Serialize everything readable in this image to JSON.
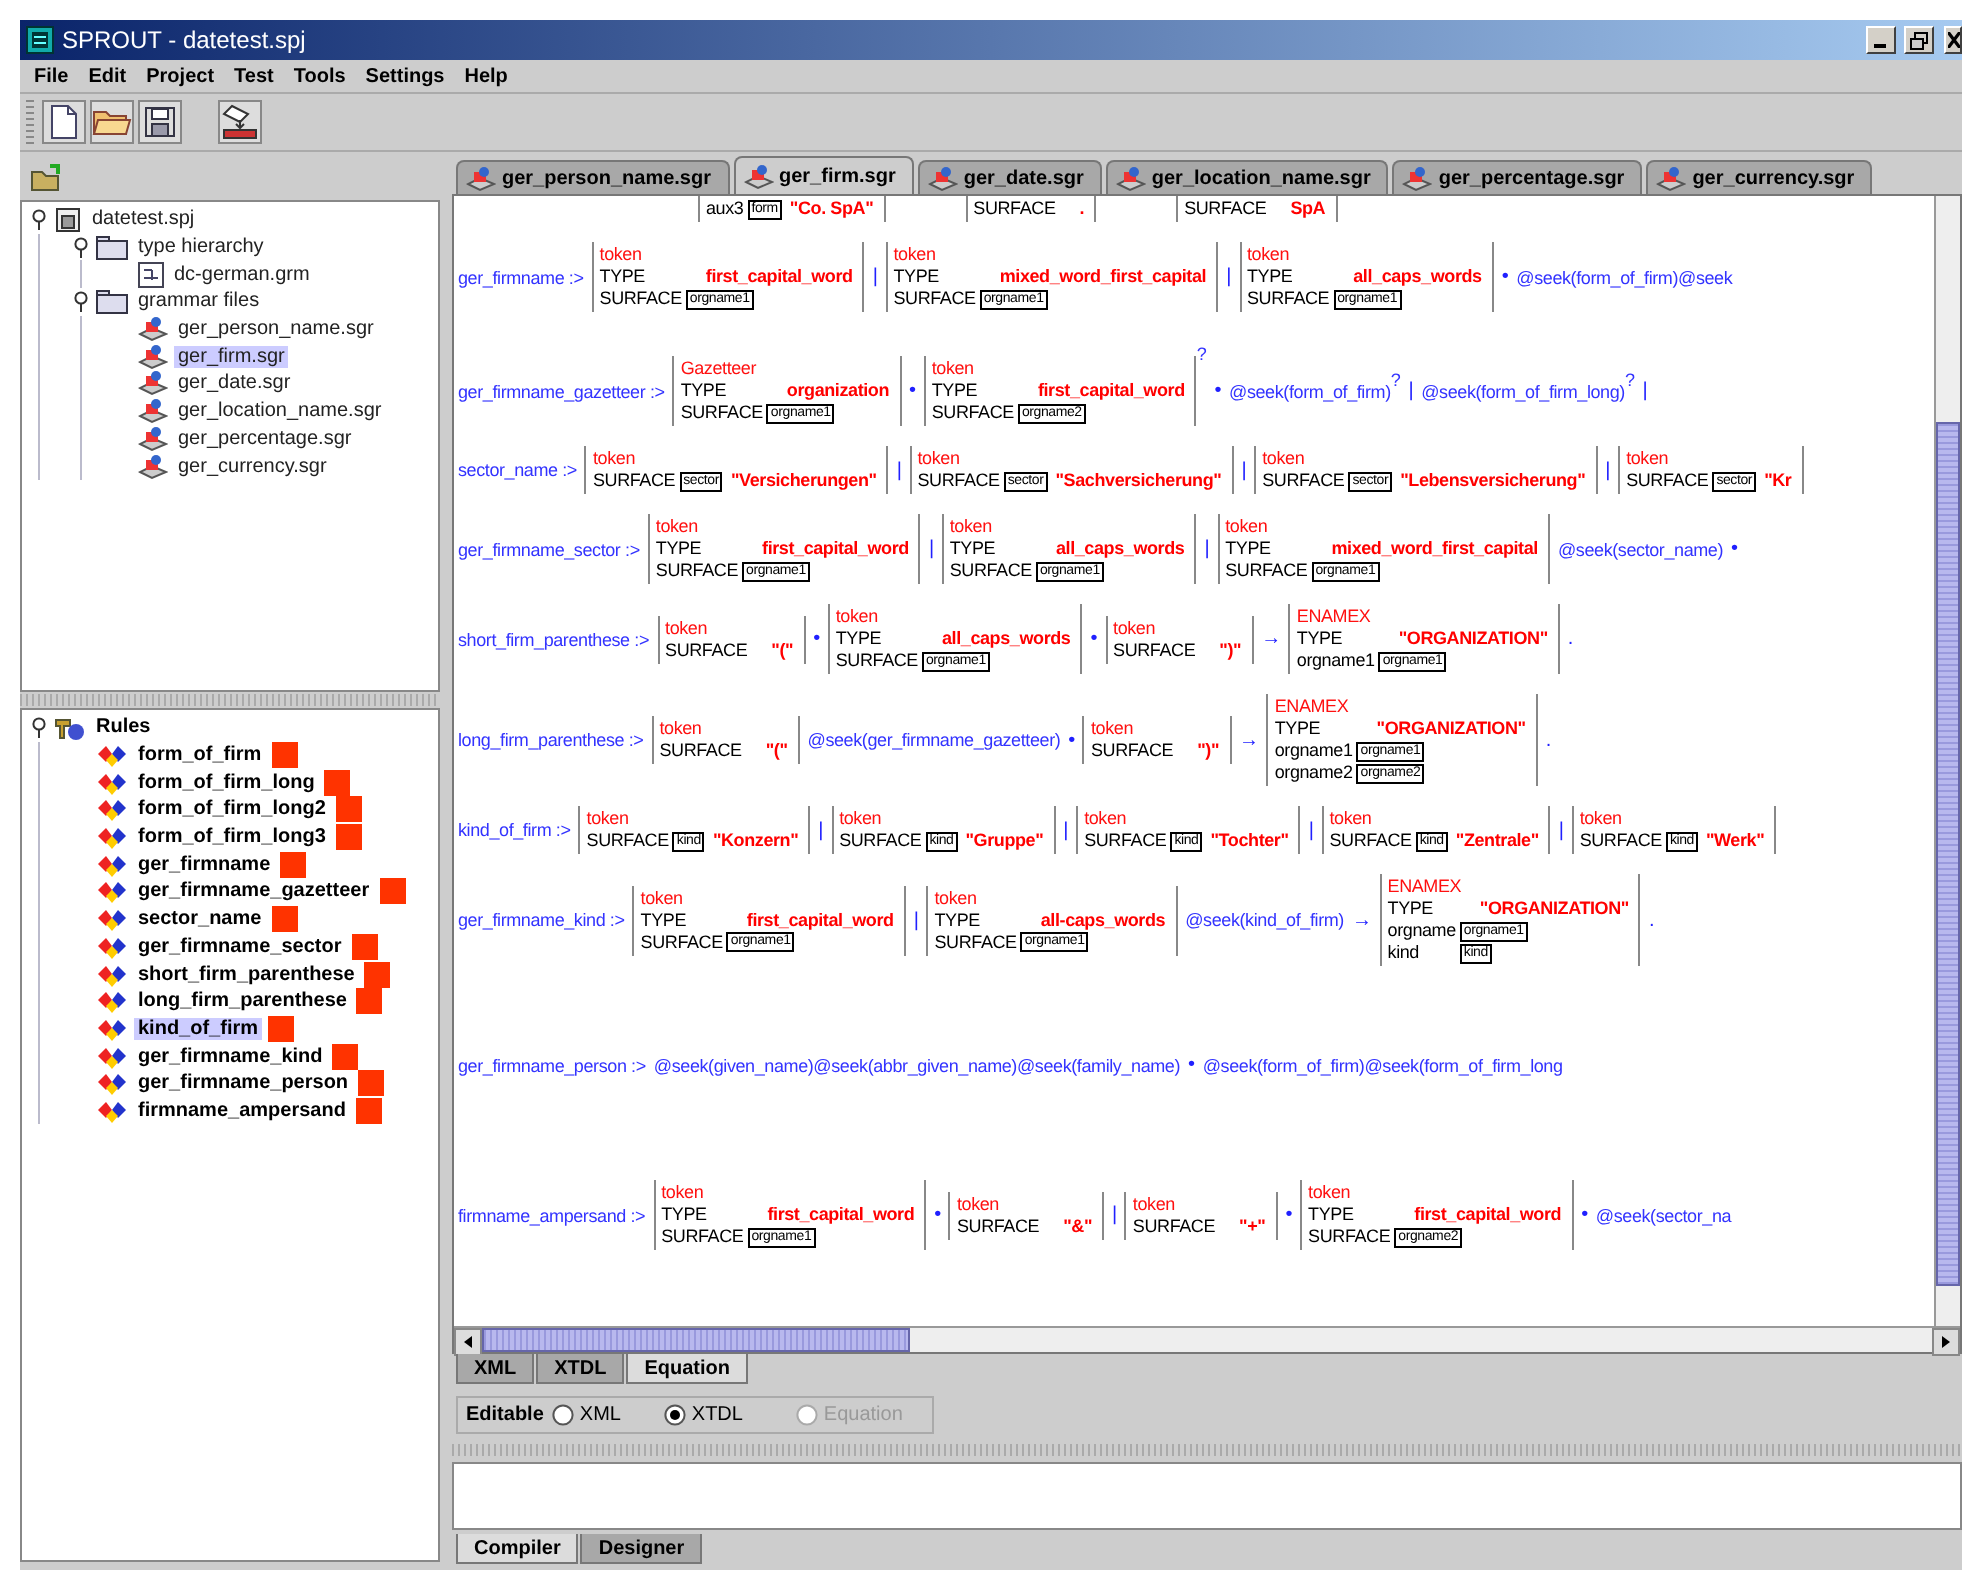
{
  "window": {
    "title": "SPROUT - datetest.spj"
  },
  "menu": [
    "File",
    "Edit",
    "Project",
    "Test",
    "Tools",
    "Settings",
    "Help"
  ],
  "project_tree": {
    "label": "datetest.spj",
    "kind": "project",
    "expanded": true,
    "children": [
      {
        "label": "type hierarchy",
        "kind": "folder",
        "expanded": true,
        "children": [
          {
            "label": "dc-german.grm",
            "kind": "grammar",
            "selected": false
          }
        ]
      },
      {
        "label": "grammar files",
        "kind": "folder",
        "expanded": true,
        "children": [
          {
            "label": "ger_person_name.sgr",
            "kind": "sgr",
            "selected": false
          },
          {
            "label": "ger_firm.sgr",
            "kind": "sgr",
            "selected": true
          },
          {
            "label": "ger_date.sgr",
            "kind": "sgr",
            "selected": false
          },
          {
            "label": "ger_location_name.sgr",
            "kind": "sgr",
            "selected": false
          },
          {
            "label": "ger_percentage.sgr",
            "kind": "sgr",
            "selected": false
          },
          {
            "label": "ger_currency.sgr",
            "kind": "sgr",
            "selected": false
          }
        ]
      }
    ]
  },
  "rules_tree": {
    "label": "Rules",
    "kind": "rules",
    "expanded": true,
    "children": [
      {
        "label": "form_of_firm",
        "kind": "rule",
        "selected": false
      },
      {
        "label": "form_of_firm_long",
        "kind": "rule",
        "selected": false
      },
      {
        "label": "form_of_firm_long2",
        "kind": "rule",
        "selected": false
      },
      {
        "label": "form_of_firm_long3",
        "kind": "rule",
        "selected": false
      },
      {
        "label": "ger_firmname",
        "kind": "rule",
        "selected": false
      },
      {
        "label": "ger_firmname_gazetteer",
        "kind": "rule",
        "selected": false
      },
      {
        "label": "sector_name",
        "kind": "rule",
        "selected": false
      },
      {
        "label": "ger_firmname_sector",
        "kind": "rule",
        "selected": false
      },
      {
        "label": "short_firm_parenthese",
        "kind": "rule",
        "selected": false
      },
      {
        "label": "long_firm_parenthese",
        "kind": "rule",
        "selected": false
      },
      {
        "label": "kind_of_firm",
        "kind": "rule",
        "selected": true
      },
      {
        "label": "ger_firmname_kind",
        "kind": "rule",
        "selected": false
      },
      {
        "label": "ger_firmname_person",
        "kind": "rule",
        "selected": false
      },
      {
        "label": "firmname_ampersand",
        "kind": "rule",
        "selected": false
      }
    ]
  },
  "file_tabs": [
    {
      "label": "ger_person_name.sgr",
      "selected": false
    },
    {
      "label": "ger_firm.sgr",
      "selected": true
    },
    {
      "label": "ger_date.sgr",
      "selected": false
    },
    {
      "label": "ger_location_name.sgr",
      "selected": false
    },
    {
      "label": "ger_percentage.sgr",
      "selected": false
    },
    {
      "label": "ger_currency.sgr",
      "selected": false
    }
  ],
  "editor": {
    "rules": [
      {
        "items": [
          {
            "kind": "fs",
            "rows": [
              {
                "attr": "aux3",
                "tag": "form",
                "value": "\"Co. SpA\""
              }
            ]
          },
          {
            "kind": "fs",
            "rows": [
              {
                "attr": "SURFACE",
                "value": "."
              }
            ]
          },
          {
            "kind": "fs",
            "rows": [
              {
                "attr": "SURFACE",
                "value": "SpA"
              }
            ]
          }
        ]
      },
      {
        "name": "ger_firmname :>",
        "items": [
          {
            "kind": "fs",
            "label": "token",
            "rows": [
              {
                "attr": "TYPE",
                "value": "first_capital_word"
              },
              {
                "attr": "SURFACE",
                "tag": "orgname1"
              }
            ]
          },
          {
            "kind": "op",
            "text": "|"
          },
          {
            "kind": "fs",
            "label": "token",
            "rows": [
              {
                "attr": "TYPE",
                "value": "mixed_word_first_capital"
              },
              {
                "attr": "SURFACE",
                "tag": "orgname1"
              }
            ]
          },
          {
            "kind": "op",
            "text": "|"
          },
          {
            "kind": "fs",
            "label": "token",
            "rows": [
              {
                "attr": "TYPE",
                "value": "all_caps_words"
              },
              {
                "attr": "SURFACE",
                "tag": "orgname1"
              }
            ]
          },
          {
            "kind": "op",
            "text": "•"
          },
          {
            "kind": "call",
            "text": "@seek(form_of_firm)@seek"
          }
        ]
      },
      {
        "name": "ger_firmname_gazetteer :>",
        "items": [
          {
            "kind": "fs",
            "label": "Gazetteer",
            "rows": [
              {
                "attr": "TYPE",
                "value": "organization"
              },
              {
                "attr": "SURFACE",
                "tag": "orgname1"
              }
            ]
          },
          {
            "kind": "op",
            "text": "•"
          },
          {
            "kind": "fs",
            "label": "token",
            "suffix": "?",
            "rows": [
              {
                "attr": "TYPE",
                "value": "first_capital_word"
              },
              {
                "attr": "SURFACE",
                "tag": "orgname2"
              }
            ]
          },
          {
            "kind": "op",
            "text": "•"
          },
          {
            "kind": "call",
            "text": "@seek(form_of_firm)",
            "suffix": "?"
          },
          {
            "kind": "op",
            "text": "|"
          },
          {
            "kind": "call",
            "text": "@seek(form_of_firm_long)",
            "suffix": "?"
          },
          {
            "kind": "op",
            "text": "|"
          }
        ]
      },
      {
        "name": "sector_name :>",
        "items": [
          {
            "kind": "fs",
            "label": "token",
            "rows": [
              {
                "attr": "SURFACE",
                "tag": "sector",
                "value": "\"Versicherungen\""
              }
            ]
          },
          {
            "kind": "op",
            "text": "|"
          },
          {
            "kind": "fs",
            "label": "token",
            "rows": [
              {
                "attr": "SURFACE",
                "tag": "sector",
                "value": "\"Sachversicherung\""
              }
            ]
          },
          {
            "kind": "op",
            "text": "|"
          },
          {
            "kind": "fs",
            "label": "token",
            "rows": [
              {
                "attr": "SURFACE",
                "tag": "sector",
                "value": "\"Lebensversicherung\""
              }
            ]
          },
          {
            "kind": "op",
            "text": "|"
          },
          {
            "kind": "fs",
            "label": "token",
            "rows": [
              {
                "attr": "SURFACE",
                "tag": "sector",
                "value": "\"Kr"
              }
            ]
          }
        ]
      },
      {
        "name": "ger_firmname_sector :>",
        "items": [
          {
            "kind": "fs",
            "label": "token",
            "rows": [
              {
                "attr": "TYPE",
                "value": "first_capital_word"
              },
              {
                "attr": "SURFACE",
                "tag": "orgname1"
              }
            ]
          },
          {
            "kind": "op",
            "text": "|"
          },
          {
            "kind": "fs",
            "label": "token",
            "rows": [
              {
                "attr": "TYPE",
                "value": "all_caps_words"
              },
              {
                "attr": "SURFACE",
                "tag": "orgname1"
              }
            ]
          },
          {
            "kind": "op",
            "text": "|"
          },
          {
            "kind": "fs",
            "label": "token",
            "rows": [
              {
                "attr": "TYPE",
                "value": "mixed_word_first_capital"
              },
              {
                "attr": "SURFACE",
                "tag": "orgname1"
              }
            ]
          },
          {
            "kind": "call",
            "text": "@seek(sector_name)"
          },
          {
            "kind": "op",
            "text": "•"
          }
        ]
      },
      {
        "name": "short_firm_parenthese :>",
        "items": [
          {
            "kind": "fs",
            "label": "token",
            "rows": [
              {
                "attr": "SURFACE",
                "value": "\"(\""
              }
            ]
          },
          {
            "kind": "op",
            "text": "•"
          },
          {
            "kind": "fs",
            "label": "token",
            "rows": [
              {
                "attr": "TYPE",
                "value": "all_caps_words"
              },
              {
                "attr": "SURFACE",
                "tag": "orgname1"
              }
            ]
          },
          {
            "kind": "op",
            "text": "•"
          },
          {
            "kind": "fs",
            "label": "token",
            "rows": [
              {
                "attr": "SURFACE",
                "value": "\")\""
              }
            ]
          },
          {
            "kind": "op",
            "text": "→"
          },
          {
            "kind": "fs",
            "label": "ENAMEX",
            "rows": [
              {
                "attr": "TYPE",
                "value": "\"ORGANIZATION\""
              },
              {
                "attr": "orgname1",
                "tag": "orgname1"
              }
            ]
          },
          {
            "kind": "op",
            "text": "."
          }
        ]
      },
      {
        "name": "long_firm_parenthese :>",
        "items": [
          {
            "kind": "fs",
            "label": "token",
            "rows": [
              {
                "attr": "SURFACE",
                "value": "\"(\""
              }
            ]
          },
          {
            "kind": "call",
            "text": "@seek(ger_firmname_gazetteer)"
          },
          {
            "kind": "op",
            "text": "•"
          },
          {
            "kind": "fs",
            "label": "token",
            "rows": [
              {
                "attr": "SURFACE",
                "value": "\")\""
              }
            ]
          },
          {
            "kind": "op",
            "text": "→"
          },
          {
            "kind": "fs",
            "label": "ENAMEX",
            "rows": [
              {
                "attr": "TYPE",
                "value": "\"ORGANIZATION\""
              },
              {
                "attr": "orgname1",
                "tag": "orgname1"
              },
              {
                "attr": "orgname2",
                "tag": "orgname2"
              }
            ]
          },
          {
            "kind": "op",
            "text": "."
          }
        ]
      },
      {
        "name": "kind_of_firm :>",
        "items": [
          {
            "kind": "fs",
            "label": "token",
            "rows": [
              {
                "attr": "SURFACE",
                "tag": "kind",
                "value": "\"Konzern\""
              }
            ]
          },
          {
            "kind": "op",
            "text": "|"
          },
          {
            "kind": "fs",
            "label": "token",
            "rows": [
              {
                "attr": "SURFACE",
                "tag": "kind",
                "value": "\"Gruppe\""
              }
            ]
          },
          {
            "kind": "op",
            "text": "|"
          },
          {
            "kind": "fs",
            "label": "token",
            "rows": [
              {
                "attr": "SURFACE",
                "tag": "kind",
                "value": "\"Tochter\""
              }
            ]
          },
          {
            "kind": "op",
            "text": "|"
          },
          {
            "kind": "fs",
            "label": "token",
            "rows": [
              {
                "attr": "SURFACE",
                "tag": "kind",
                "value": "\"Zentrale\""
              }
            ]
          },
          {
            "kind": "op",
            "text": "|"
          },
          {
            "kind": "fs",
            "label": "token",
            "rows": [
              {
                "attr": "SURFACE",
                "tag": "kind",
                "value": "\"Werk\""
              }
            ]
          }
        ]
      },
      {
        "name": "ger_firmname_kind :>",
        "items": [
          {
            "kind": "fs",
            "label": "token",
            "rows": [
              {
                "attr": "TYPE",
                "value": "first_capital_word"
              },
              {
                "attr": "SURFACE",
                "tag": "orgname1"
              }
            ]
          },
          {
            "kind": "op",
            "text": "|"
          },
          {
            "kind": "fs",
            "label": "token",
            "rows": [
              {
                "attr": "TYPE",
                "value": "all-caps_words"
              },
              {
                "attr": "SURFACE",
                "tag": "orgname1"
              }
            ]
          },
          {
            "kind": "call",
            "text": "@seek(kind_of_firm)"
          },
          {
            "kind": "op",
            "text": "→"
          },
          {
            "kind": "fs",
            "label": "ENAMEX",
            "rows": [
              {
                "attr": "TYPE",
                "value": "\"ORGANIZATION\""
              },
              {
                "attr": "orgname",
                "tag": "orgname1"
              },
              {
                "attr": "kind",
                "tag": "kind"
              }
            ]
          },
          {
            "kind": "op",
            "text": "."
          }
        ]
      },
      {
        "name": "ger_firmname_person :>",
        "items": [
          {
            "kind": "call",
            "text": "@seek(given_name)@seek(abbr_given_name)@seek(family_name)"
          },
          {
            "kind": "op",
            "text": "•"
          },
          {
            "kind": "call",
            "text": "@seek(form_of_firm)@seek(form_of_firm_long"
          }
        ]
      },
      {
        "name": "firmname_ampersand :>",
        "items": [
          {
            "kind": "fs",
            "label": "token",
            "rows": [
              {
                "attr": "TYPE",
                "value": "first_capital_word"
              },
              {
                "attr": "SURFACE",
                "tag": "orgname1"
              }
            ]
          },
          {
            "kind": "op",
            "text": "•"
          },
          {
            "kind": "fs",
            "label": "token",
            "rows": [
              {
                "attr": "SURFACE",
                "value": "\"&\""
              }
            ]
          },
          {
            "kind": "op",
            "text": "|"
          },
          {
            "kind": "fs",
            "label": "token",
            "rows": [
              {
                "attr": "SURFACE",
                "value": "\"+\""
              }
            ]
          },
          {
            "kind": "op",
            "text": "•"
          },
          {
            "kind": "fs",
            "label": "token",
            "rows": [
              {
                "attr": "TYPE",
                "value": "first_capital_word"
              },
              {
                "attr": "SURFACE",
                "tag": "orgname2"
              }
            ]
          },
          {
            "kind": "op",
            "text": "•"
          },
          {
            "kind": "call",
            "text": "@seek(sector_na"
          }
        ]
      }
    ]
  },
  "view_tabs": [
    {
      "label": "XML",
      "selected": false
    },
    {
      "label": "XTDL",
      "selected": false
    },
    {
      "label": "Equation",
      "selected": true
    }
  ],
  "editable": {
    "label": "Editable",
    "options": [
      {
        "label": "XML",
        "selected": false,
        "disabled": false
      },
      {
        "label": "XTDL",
        "selected": true,
        "disabled": false
      },
      {
        "label": "Equation",
        "selected": false,
        "disabled": true
      }
    ]
  },
  "bottom_tabs": [
    {
      "label": "Compiler",
      "selected": true
    },
    {
      "label": "Designer",
      "selected": false
    }
  ]
}
